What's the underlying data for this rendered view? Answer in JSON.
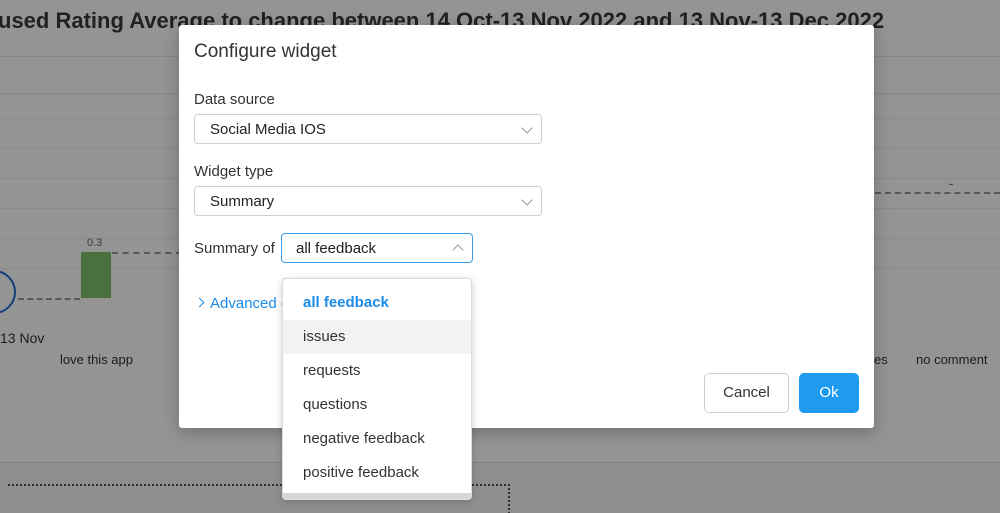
{
  "background": {
    "chart_title": "used Rating Average to change between 14 Oct-13 Nov 2022 and 13 Nov-13 Dec 2022",
    "bar_value_label": "0.3",
    "date_label": "13 Nov",
    "category_left": "love this app",
    "category_right_partial": "es",
    "category_right": "no comment",
    "tick_dash": "-"
  },
  "modal": {
    "title": "Configure widget",
    "data_source": {
      "label": "Data source",
      "value": "Social Media IOS"
    },
    "widget_type": {
      "label": "Widget type",
      "value": "Summary"
    },
    "summary_of": {
      "label": "Summary of",
      "value": "all feedback"
    },
    "advanced_label": "Advanced o",
    "cancel_label": "Cancel",
    "ok_label": "Ok"
  },
  "dropdown": {
    "options": [
      {
        "label": "all feedback",
        "state": "selected"
      },
      {
        "label": "issues",
        "state": "hover"
      },
      {
        "label": "requests",
        "state": "normal"
      },
      {
        "label": "questions",
        "state": "normal"
      },
      {
        "label": "negative feedback",
        "state": "normal"
      },
      {
        "label": "positive feedback",
        "state": "normal"
      }
    ]
  },
  "colors": {
    "accent": "#1a8be8",
    "ok_button": "#1e9bf0",
    "bar": "#7fc26a",
    "overlay": "rgba(0,0,0,0.42)"
  }
}
